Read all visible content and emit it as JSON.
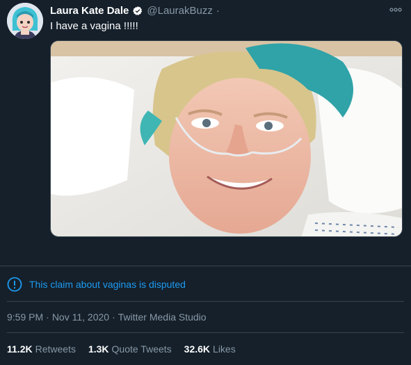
{
  "author": {
    "display_name": "Laura Kate Dale",
    "handle": "@LaurakBuzz",
    "separator": "·",
    "verified_icon": "verified-badge-icon"
  },
  "tweet": {
    "text": "I have a vagina !!!!!"
  },
  "media": {
    "subject": "selfie photo of a person lying in a hospital bed with a nasal cannula"
  },
  "notice": {
    "icon": "exclamation-circle-icon",
    "text": "This claim about vaginas is disputed"
  },
  "meta": {
    "time": "9:59 PM",
    "sep1": "·",
    "date": "Nov 11, 2020",
    "sep2": "·",
    "source": "Twitter Media Studio"
  },
  "stats": [
    {
      "count": "11.2K",
      "label": "Retweets"
    },
    {
      "count": "1.3K",
      "label": "Quote Tweets"
    },
    {
      "count": "32.6K",
      "label": "Likes"
    }
  ],
  "colors": {
    "background": "#15202b",
    "accent": "#1d9bf0",
    "muted": "#8899a6",
    "divider": "#38444d"
  }
}
